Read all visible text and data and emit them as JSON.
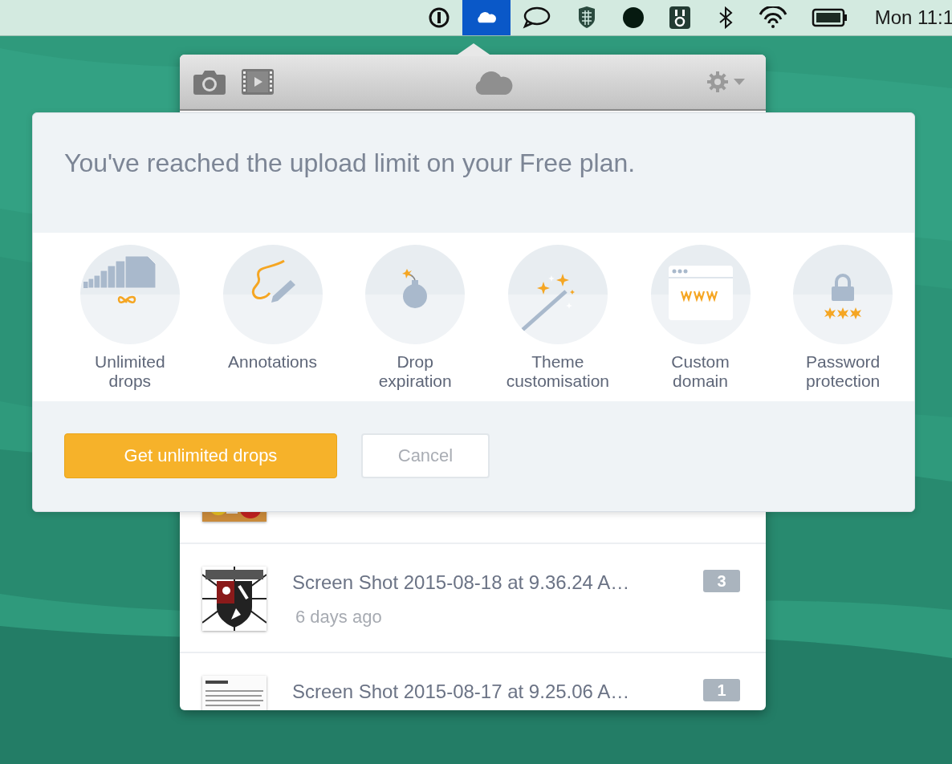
{
  "menu_bar": {
    "items": [
      {
        "kind": "keyhole",
        "selected": false
      },
      {
        "kind": "cloud",
        "selected": true
      },
      {
        "kind": "bubble",
        "selected": false
      },
      {
        "kind": "shield",
        "selected": false
      },
      {
        "kind": "dot",
        "selected": false
      },
      {
        "kind": "outlet",
        "selected": false
      },
      {
        "kind": "bluetooth",
        "selected": false
      },
      {
        "kind": "wifi",
        "selected": false
      },
      {
        "kind": "battery",
        "selected": false
      }
    ],
    "clock": "Mon 11:1"
  },
  "popover": {
    "rows": [
      {
        "title": "Screen Shot 2015-08-18 at 9.36.24 A…",
        "time": "6 days ago",
        "count": "3"
      },
      {
        "title": "Screen Shot 2015-08-17 at 9.25.06 A…",
        "count": "1"
      }
    ]
  },
  "dialog": {
    "message": "You've reached the upload limit on your Free plan.",
    "features": [
      {
        "label": "Unlimited drops",
        "kind": "stack"
      },
      {
        "label": "Annotations",
        "kind": "pen"
      },
      {
        "label": "Drop expiration",
        "kind": "bomb"
      },
      {
        "label": "Theme customisation",
        "kind": "wand"
      },
      {
        "label": "Custom domain",
        "kind": "browser"
      },
      {
        "label": "Password protection",
        "kind": "lock"
      }
    ],
    "buttons": [
      {
        "label": "Get unlimited drops",
        "kind": "primary"
      },
      {
        "label": "Cancel",
        "kind": "secondary"
      }
    ]
  }
}
